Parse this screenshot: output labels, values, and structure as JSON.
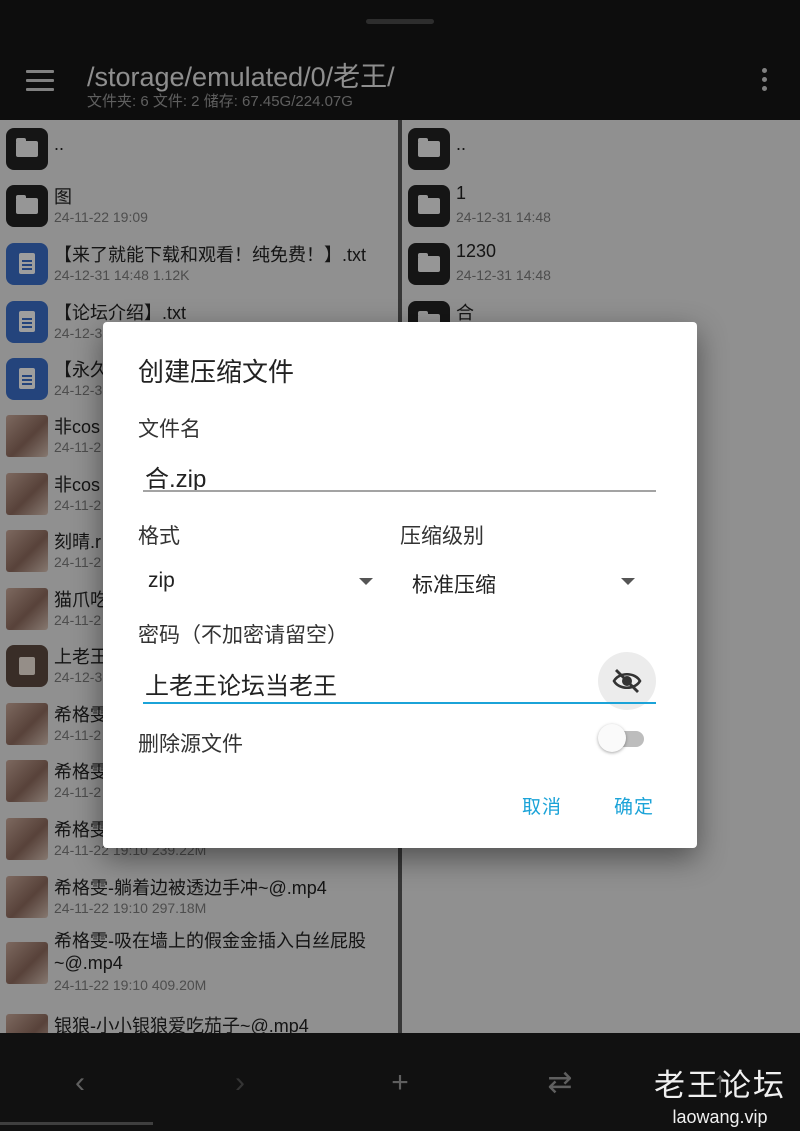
{
  "header": {
    "path": "/storage/emulated/0/老王/",
    "stats": "文件夹: 6  文件: 2  储存: 67.45G/224.07G"
  },
  "left_pane": {
    "items": [
      {
        "name": "..",
        "meta": "",
        "icon": "folder-icon"
      },
      {
        "name": "图",
        "meta": "24-11-22 19:09",
        "icon": "folder-icon"
      },
      {
        "name": "【来了就能下载和观看！纯免费！】.txt",
        "meta": "24-12-31 14:48  1.12K",
        "icon": "text-file-icon"
      },
      {
        "name": "【论坛介绍】.txt",
        "meta": "24-12-3",
        "icon": "text-file-icon"
      },
      {
        "name": "【永久",
        "meta": "24-12-3",
        "icon": "text-file-icon"
      },
      {
        "name": "非cos",
        "meta": "24-11-2",
        "icon": "video-thumbnail"
      },
      {
        "name": "非cos",
        "meta": "24-11-2",
        "icon": "video-thumbnail"
      },
      {
        "name": "刻晴.r",
        "meta": "24-11-2",
        "icon": "video-thumbnail"
      },
      {
        "name": "猫爪吃",
        "meta": "24-11-2",
        "icon": "video-thumbnail"
      },
      {
        "name": "上老王",
        "meta": "24-12-3",
        "icon": "archive-icon"
      },
      {
        "name": "希格雯",
        "meta": "24-11-2",
        "icon": "video-thumbnail"
      },
      {
        "name": "希格雯",
        "meta": "24-11-2",
        "icon": "video-thumbnail"
      },
      {
        "name": "希格雯",
        "meta": "24-11-22 19:10  239.22M",
        "icon": "video-thumbnail"
      },
      {
        "name": "希格雯-躺着边被透边手冲~@.mp4",
        "meta": "24-11-22 19:10  297.18M",
        "icon": "video-thumbnail"
      },
      {
        "name": "希格雯-吸在墙上的假金金插入白丝屁股~@.mp4",
        "meta": "24-11-22 19:10  409.20M",
        "icon": "video-thumbnail"
      },
      {
        "name": "银狼-小小银狼爱吃茄子~@.mp4",
        "meta": "",
        "icon": "video-thumbnail"
      }
    ]
  },
  "right_pane": {
    "items": [
      {
        "name": "..",
        "meta": "",
        "icon": "folder-icon"
      },
      {
        "name": "1",
        "meta": "24-12-31 14:48",
        "icon": "folder-icon"
      },
      {
        "name": "1230",
        "meta": "24-12-31 14:48",
        "icon": "folder-icon"
      },
      {
        "name": "合",
        "meta": "",
        "icon": "folder-icon"
      }
    ]
  },
  "dialog": {
    "title": "创建压缩文件",
    "filename_label": "文件名",
    "filename_value": "合.zip",
    "format_label": "格式",
    "format_value": "zip",
    "level_label": "压缩级别",
    "level_value": "标准压缩",
    "password_label": "密码（不加密请留空）",
    "password_value": "上老王论坛当老王",
    "delete_source_label": "删除源文件",
    "delete_source_on": false,
    "cancel_label": "取消",
    "confirm_label": "确定"
  },
  "bottom_bar": {
    "back_icon": "‹",
    "forward_icon": "›",
    "add_icon": "+",
    "swap_icon": "⇄",
    "up_icon": "↑"
  },
  "watermark": {
    "title": "老王论坛",
    "url": "laowang.vip"
  },
  "colors": {
    "accent": "#1ba3d8",
    "topbar": "#161616",
    "pane": "#e9e9e9"
  }
}
